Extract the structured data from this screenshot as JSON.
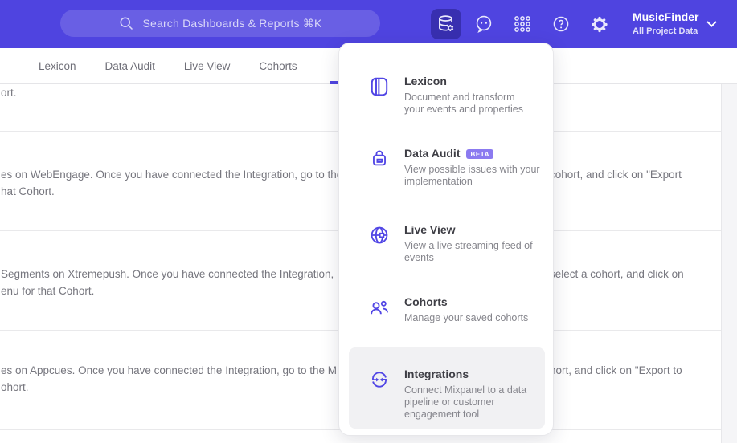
{
  "colors": {
    "nav_purple": "#4f44e0",
    "accent_purple": "#5146e5",
    "menu_title": "#3e3e45",
    "menu_desc": "#85858c",
    "body_text": "#76767e",
    "beta_badge_bg": "#8b7af0",
    "highlight_bg": "#f1f1f3"
  },
  "topbar": {
    "search_placeholder": "Search Dashboards & Reports ⌘K",
    "project_name": "MusicFinder",
    "project_scope": "All Project Data"
  },
  "tabs": {
    "items": [
      "Lexicon",
      "Data Audit",
      "Live View",
      "Cohorts"
    ]
  },
  "menu": {
    "items": [
      {
        "title": "Lexicon",
        "desc": "Document and transform\nyour events and properties"
      },
      {
        "title": "Data Audit",
        "badge": "BETA",
        "desc": "View possible issues with your\nimplementation"
      },
      {
        "title": "Live View",
        "desc": "View a live streaming feed of\nevents"
      },
      {
        "title": "Cohorts",
        "desc": "Manage your saved cohorts"
      },
      {
        "title": "Integrations",
        "desc": "Connect Mixpanel to a data\npipeline or customer\nengagement tool"
      }
    ]
  },
  "content": {
    "row1": {
      "line2": "ort."
    },
    "row2": {
      "line1_left": "es on WebEngage. Once you have connected the Integration, go to the",
      "line1_right": "cohort, and click on \"Export",
      "line2": "hat Cohort."
    },
    "row3": {
      "line1_left": "Segments on Xtremepush. Once you have connected the Integration,",
      "line1_right": "select a cohort, and click on",
      "line2": "enu for that Cohort."
    },
    "row4": {
      "line1_left": "es on Appcues. Once you have connected the Integration, go to the M",
      "line1_right": "hort, and click on \"Export to",
      "line2": "ohort."
    }
  }
}
